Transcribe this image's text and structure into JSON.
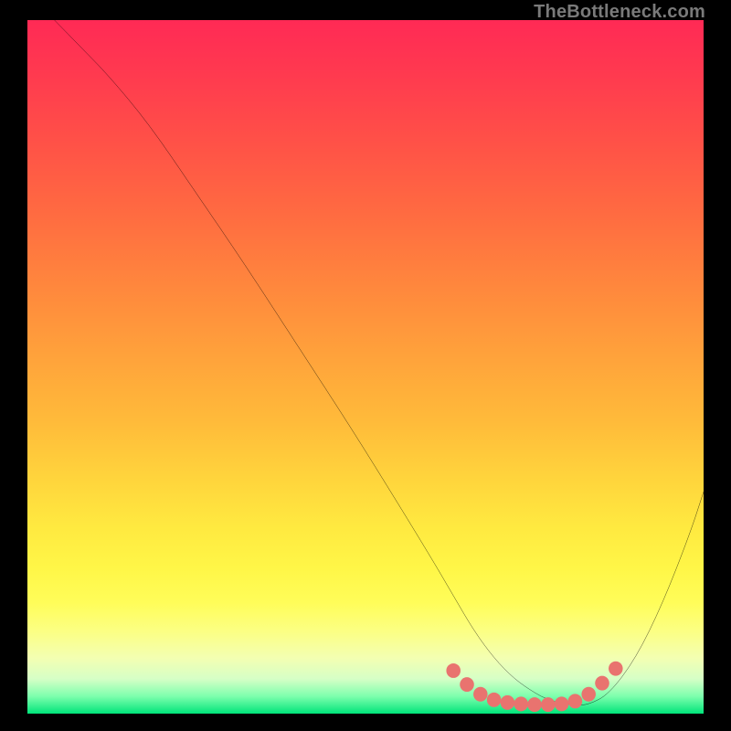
{
  "watermark": {
    "text": "TheBottleneck.com"
  },
  "chart_data": {
    "type": "line",
    "title": "",
    "xlabel": "",
    "ylabel": "",
    "xlim": [
      0,
      100
    ],
    "ylim": [
      0,
      100
    ],
    "grid": false,
    "legend": false,
    "series": [
      {
        "name": "curve",
        "color": "#000000",
        "x": [
          4,
          8,
          12,
          18,
          25,
          32,
          40,
          48,
          55,
          60,
          63,
          66,
          69,
          72,
          75,
          77,
          79,
          81,
          83,
          86,
          90,
          94,
          98,
          100
        ],
        "y": [
          100,
          96,
          92,
          85,
          75,
          65,
          53,
          41,
          30,
          22,
          17,
          12,
          8,
          5,
          3,
          2,
          1.5,
          1.2,
          1.3,
          2.8,
          8,
          16,
          26,
          32
        ]
      }
    ],
    "markers": {
      "name": "floor-dots",
      "color": "#e9736f",
      "radius_pct": 1.05,
      "points": [
        {
          "x": 63,
          "y": 6.2
        },
        {
          "x": 65,
          "y": 4.2
        },
        {
          "x": 67,
          "y": 2.8
        },
        {
          "x": 69,
          "y": 2.0
        },
        {
          "x": 71,
          "y": 1.6
        },
        {
          "x": 73,
          "y": 1.4
        },
        {
          "x": 75,
          "y": 1.3
        },
        {
          "x": 77,
          "y": 1.3
        },
        {
          "x": 79,
          "y": 1.4
        },
        {
          "x": 81,
          "y": 1.8
        },
        {
          "x": 83,
          "y": 2.8
        },
        {
          "x": 85,
          "y": 4.4
        },
        {
          "x": 87,
          "y": 6.5
        }
      ]
    }
  }
}
